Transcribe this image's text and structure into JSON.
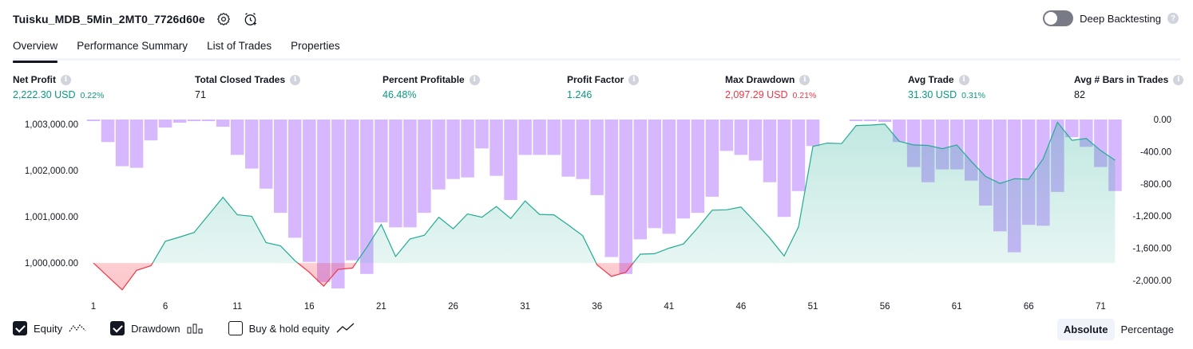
{
  "header": {
    "strategy_name": "Tuisku_MDB_5Min_2MT0_7726d60e",
    "deep_backtesting_label": "Deep Backtesting",
    "help_glyph": "?"
  },
  "tabs": [
    {
      "label": "Overview",
      "active": true
    },
    {
      "label": "Performance Summary",
      "active": false
    },
    {
      "label": "List of Trades",
      "active": false
    },
    {
      "label": "Properties",
      "active": false
    }
  ],
  "metrics": [
    {
      "label": "Net Profit",
      "value": "2,222.30 USD",
      "pct": "0.22%",
      "color": "#089981"
    },
    {
      "label": "Total Closed Trades",
      "value": "71",
      "pct": "",
      "color": "#131722"
    },
    {
      "label": "Percent Profitable",
      "value": "46.48%",
      "pct": "",
      "color": "#089981"
    },
    {
      "label": "Profit Factor",
      "value": "1.246",
      "pct": "",
      "color": "#089981"
    },
    {
      "label": "Max Drawdown",
      "value": "2,097.29 USD",
      "pct": "0.21%",
      "color": "#f23645"
    },
    {
      "label": "Avg Trade",
      "value": "31.30 USD",
      "pct": "0.31%",
      "color": "#089981"
    },
    {
      "label": "Avg # Bars in Trades",
      "value": "82",
      "pct": "",
      "color": "#131722"
    }
  ],
  "info_glyph": "i",
  "legend": [
    {
      "label": "Equity",
      "checked": true,
      "icon": "equity-line-icon"
    },
    {
      "label": "Drawdown",
      "checked": true,
      "icon": "drawdown-bars-icon"
    },
    {
      "label": "Buy & hold equity",
      "checked": false,
      "icon": "buy-hold-line-icon"
    }
  ],
  "view_mode": {
    "options": [
      "Absolute",
      "Percentage"
    ],
    "selected": "Absolute"
  },
  "colors": {
    "equity_line": "#22ab94",
    "equity_negative": "#f23645",
    "drawdown": "#c9a0ff",
    "text": "#131722"
  },
  "chart_data": {
    "type": "area",
    "x_ticks": [
      1,
      6,
      11,
      16,
      21,
      26,
      31,
      36,
      41,
      46,
      51,
      56,
      61,
      66,
      71
    ],
    "left_axis": {
      "ticks": [
        "1,003,000.00",
        "1,002,000.00",
        "1,001,000.00",
        "1,000,000.00"
      ],
      "values": [
        1003000,
        1002000,
        1001000,
        1000000
      ],
      "ylim": [
        999450,
        1003100
      ]
    },
    "right_axis": {
      "ticks": [
        "0.00",
        "-400.00",
        "-800.00",
        "-1,200.00",
        "-1,600.00",
        "-2,000.00"
      ],
      "values": [
        0,
        -400,
        -800,
        -1200,
        -1600,
        -2000
      ],
      "ylim": [
        -2100,
        0
      ]
    },
    "series": [
      {
        "name": "Equity",
        "axis": "left",
        "baseline": 1000000,
        "x": [
          1,
          3,
          4,
          5,
          6,
          7,
          8,
          9,
          10,
          11,
          12,
          13,
          14,
          15,
          16,
          17,
          18,
          19,
          20,
          21,
          22,
          23,
          24,
          25,
          26,
          27,
          28,
          29,
          30,
          31,
          32,
          33,
          34,
          35,
          36,
          37,
          38,
          39,
          40,
          41,
          42,
          43,
          44,
          45,
          46,
          47,
          48,
          49,
          50,
          51,
          52,
          53,
          54,
          55,
          56,
          57,
          58,
          59,
          60,
          61,
          62,
          63,
          64,
          65,
          66,
          67,
          68,
          69,
          70,
          71,
          72
        ],
        "values": [
          1000000,
          999420,
          999840,
          999940,
          1000470,
          1000560,
          1000660,
          1001040,
          1001420,
          1001040,
          1001010,
          1000440,
          1000370,
          1000050,
          999800,
          999500,
          999860,
          999890,
          1000340,
          1000830,
          1000140,
          1000520,
          1000600,
          1000990,
          1000740,
          1001060,
          1000990,
          1001220,
          1000960,
          1001340,
          1001050,
          1001040,
          1000820,
          1000590,
          999960,
          999710,
          999800,
          1000190,
          1000200,
          1000320,
          1000410,
          1000760,
          1001140,
          1001150,
          1001210,
          1000880,
          1000540,
          1000150,
          1000780,
          1002520,
          1002590,
          1002580,
          1002970,
          1002980,
          1003000,
          1002630,
          1002550,
          1002540,
          1002470,
          1002550,
          1002200,
          1001870,
          1001720,
          1001820,
          1001810,
          1002250,
          1003040,
          1002650,
          1002690,
          1002430,
          1002220
        ]
      },
      {
        "name": "Drawdown",
        "axis": "right",
        "x": [
          1,
          2,
          3,
          4,
          5,
          6,
          7,
          8,
          9,
          10,
          11,
          12,
          13,
          14,
          15,
          16,
          17,
          18,
          19,
          20,
          21,
          22,
          23,
          24,
          25,
          26,
          27,
          28,
          29,
          30,
          31,
          32,
          33,
          34,
          35,
          36,
          37,
          38,
          39,
          40,
          41,
          42,
          43,
          44,
          45,
          46,
          47,
          48,
          49,
          50,
          51,
          52,
          53,
          54,
          55,
          56,
          57,
          58,
          59,
          60,
          61,
          62,
          63,
          64,
          65,
          66,
          67,
          68,
          69,
          70,
          71,
          72
        ],
        "values": [
          -20,
          -280,
          -580,
          -600,
          -260,
          -100,
          -40,
          -20,
          -20,
          -90,
          -440,
          -610,
          -860,
          -1160,
          -1470,
          -1770,
          -2020,
          -2100,
          -1750,
          -1920,
          -1280,
          -1340,
          -1340,
          -1160,
          -870,
          -740,
          -720,
          -360,
          -700,
          -1000,
          -440,
          -440,
          -440,
          -710,
          -740,
          -940,
          -1710,
          -1920,
          -1490,
          -1350,
          -1420,
          -1230,
          -1160,
          -960,
          -390,
          -440,
          -510,
          -780,
          -1210,
          -890,
          -330,
          0,
          0,
          -20,
          -20,
          -30,
          -280,
          -590,
          -780,
          -620,
          -620,
          -760,
          -1070,
          -1390,
          -1650,
          -1310,
          -1320,
          -900,
          -220,
          -340,
          -590,
          -890
        ]
      }
    ]
  }
}
